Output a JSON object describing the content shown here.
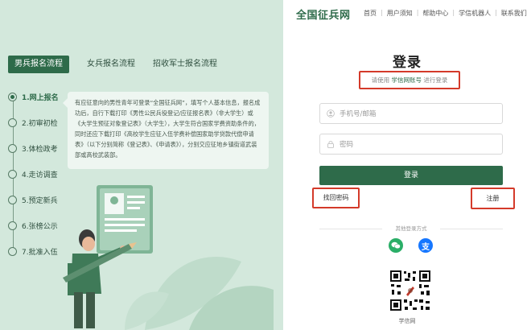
{
  "header": {
    "logo": "全国征兵网",
    "nav": [
      "首页",
      "用户须知",
      "帮助中心",
      "学信机器人",
      "联系我们"
    ]
  },
  "left": {
    "tabs": [
      "男兵报名流程",
      "女兵报名流程",
      "招收军士报名流程"
    ],
    "steps": [
      "1.网上报名",
      "2.初审初检",
      "3.体检政考",
      "4.走访调查",
      "5.预定新兵",
      "6.张榜公示",
      "7.批准入伍"
    ],
    "description": "有应征意向的男性青年可登录“全国征兵网”，填写个人基本信息，报名成功后，自行下载打印《男性公民兵役登记/应征报名表》（非大学生）或《大学生预征对象登记表》（大学生），大学生符合国家学费资助条件的，同时还应下载打印《高校学生应征入伍学费补偿国家助学贷款代偿申请表》（以下分别简称《登记表》、《申请表》），分别交应征地乡镇街道武装部或高校武装部。"
  },
  "login": {
    "title": "登录",
    "subtitle_pre": "请使用",
    "subtitle_highlight": "学信网账号",
    "subtitle_post": "进行登录",
    "phone_placeholder": "手机号/邮箱",
    "password_placeholder": "密码",
    "login_button": "登录",
    "forgot_link": "找回密码",
    "register_link": "注册",
    "other_methods": "其他登录方式",
    "alipay_glyph": "支",
    "qr_label": "学信网"
  },
  "colors": {
    "accent": "#2e6b4a",
    "left_bg": "#d3e8dc",
    "highlight_box": "#d43a2a"
  }
}
